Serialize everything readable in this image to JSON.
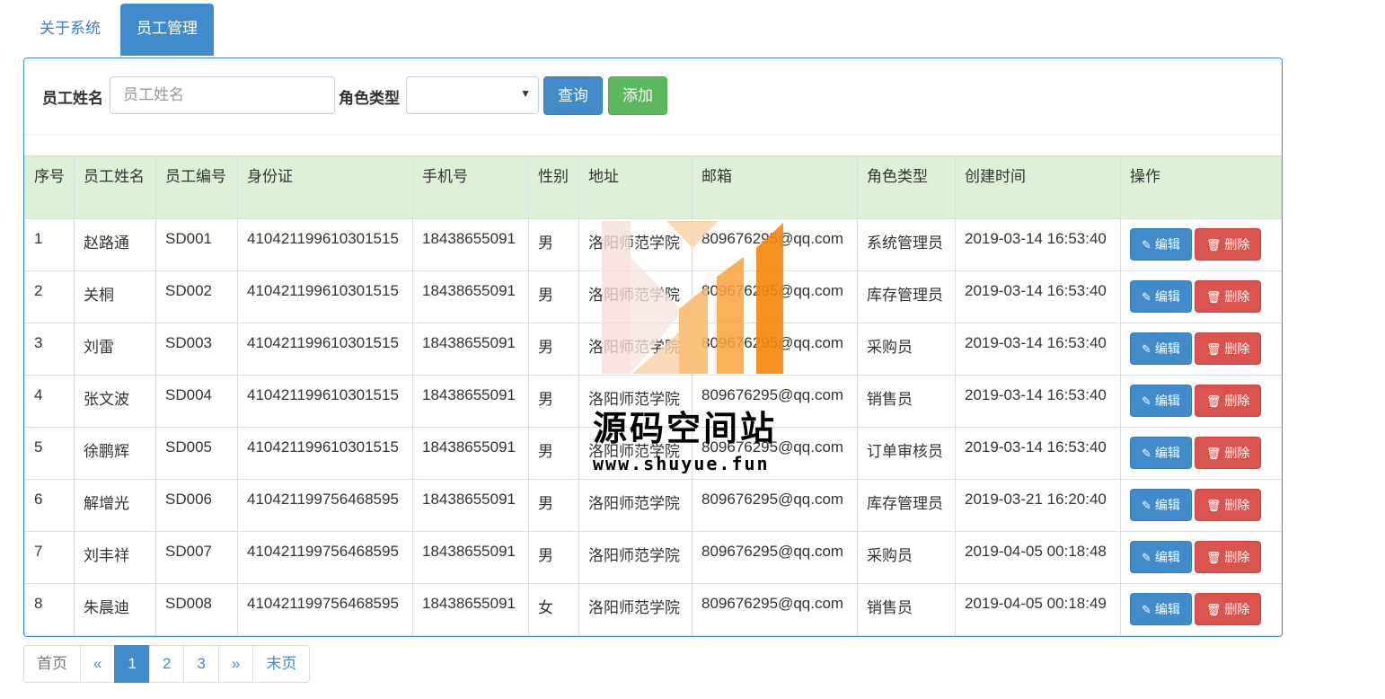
{
  "tabs": [
    {
      "label": "关于系统"
    },
    {
      "label": "员工管理",
      "close_icon": "✖"
    }
  ],
  "search": {
    "name_label": "员工姓名",
    "name_placeholder": "员工姓名",
    "role_label": "角色类型",
    "role_value": "",
    "query_label": "查询",
    "add_label": "添加"
  },
  "table": {
    "headers": [
      "序号",
      "员工姓名",
      "员工编号",
      "身份证",
      "手机号",
      "性别",
      "地址",
      "邮箱",
      "角色类型",
      "创建时间",
      "操作"
    ],
    "rows": [
      [
        "1",
        "赵路通",
        "SD001",
        "410421199610301515",
        "18438655091",
        "男",
        "洛阳师范学院",
        "809676295@qq.com",
        "系统管理员",
        "2019-03-14 16:53:40"
      ],
      [
        "2",
        "关桐",
        "SD002",
        "410421199610301515",
        "18438655091",
        "男",
        "洛阳师范学院",
        "809676295@qq.com",
        "库存管理员",
        "2019-03-14 16:53:40"
      ],
      [
        "3",
        "刘雷",
        "SD003",
        "410421199610301515",
        "18438655091",
        "男",
        "洛阳师范学院",
        "809676295@qq.com",
        "采购员",
        "2019-03-14 16:53:40"
      ],
      [
        "4",
        "张文波",
        "SD004",
        "410421199610301515",
        "18438655091",
        "男",
        "洛阳师范学院",
        "809676295@qq.com",
        "销售员",
        "2019-03-14 16:53:40"
      ],
      [
        "5",
        "徐鹏辉",
        "SD005",
        "410421199610301515",
        "18438655091",
        "男",
        "洛阳师范学院",
        "809676295@qq.com",
        "订单审核员",
        "2019-03-14 16:53:40"
      ],
      [
        "6",
        "解增光",
        "SD006",
        "410421199756468595",
        "18438655091",
        "男",
        "洛阳师范学院",
        "809676295@qq.com",
        "库存管理员",
        "2019-03-21 16:20:40"
      ],
      [
        "7",
        "刘丰祥",
        "SD007",
        "410421199756468595",
        "18438655091",
        "男",
        "洛阳师范学院",
        "809676295@qq.com",
        "采购员",
        "2019-04-05 00:18:48"
      ],
      [
        "8",
        "朱晨迪",
        "SD008",
        "410421199756468595",
        "18438655091",
        "女",
        "洛阳师范学院",
        "809676295@qq.com",
        "销售员",
        "2019-04-05 00:18:49"
      ]
    ],
    "edit_label": "编辑",
    "delete_label": "删除",
    "edit_icon": "pencil-icon",
    "delete_icon": "trash-icon"
  },
  "pagination": {
    "first": "首页",
    "prev": "«",
    "pages": [
      "1",
      "2",
      "3"
    ],
    "active_page": "1",
    "next": "»",
    "last": "末页"
  },
  "watermark": {
    "text": "源码空间站",
    "url": "www.shuyue.fun"
  },
  "colors": {
    "primary": "#428bca",
    "success": "#5cb85c",
    "danger": "#d9534f",
    "header_bg": "#dff0d8"
  }
}
